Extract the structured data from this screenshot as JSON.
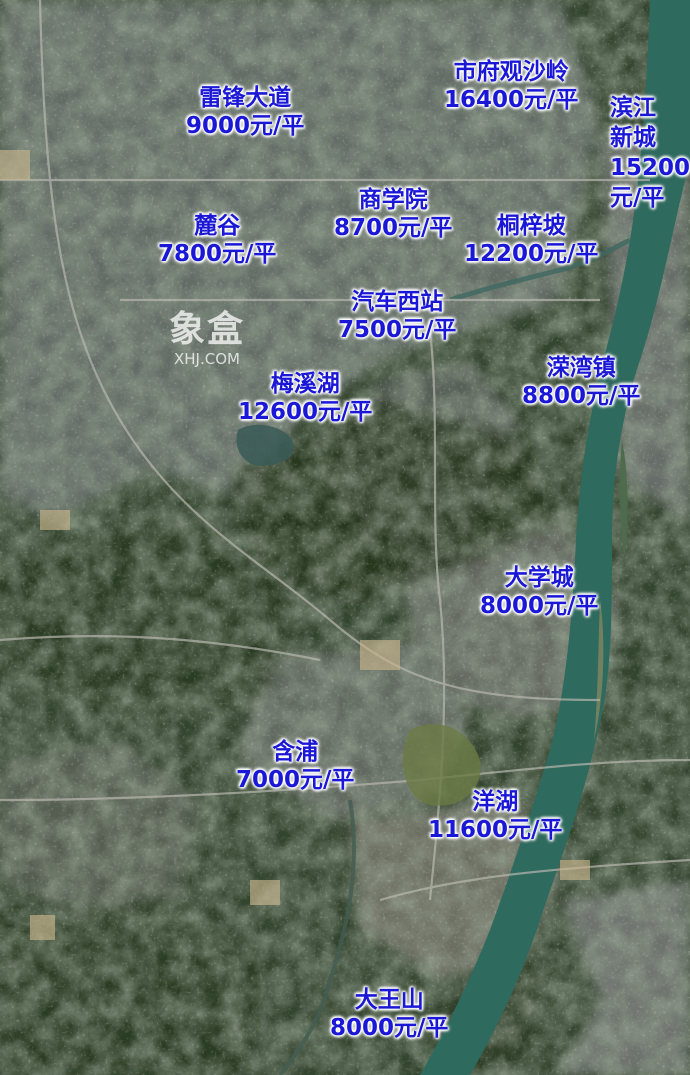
{
  "map": {
    "type": "satellite",
    "label_color": "#1a17d6",
    "river_color": "#2f6a5e",
    "labels": [
      {
        "id": "leifeng",
        "name": "雷锋大道",
        "price": "9000元/平"
      },
      {
        "id": "shifu",
        "name": "市府观沙岭",
        "price": "16400元/平"
      },
      {
        "id": "binjiang",
        "name_lines": [
          "滨江",
          "新城",
          "15200",
          "元/平"
        ]
      },
      {
        "id": "shangxueyuan",
        "name": "商学院",
        "price": "8700元/平"
      },
      {
        "id": "lugu",
        "name": "麓谷",
        "price": "7800元/平"
      },
      {
        "id": "tongzipo",
        "name": "桐梓坡",
        "price": "12200元/平"
      },
      {
        "id": "qichexizhan",
        "name": "汽车西站",
        "price": "7500元/平"
      },
      {
        "id": "meixihu",
        "name": "梅溪湖",
        "price": "12600元/平"
      },
      {
        "id": "lanwanzhen",
        "name": "溁湾镇",
        "price": "8800元/平"
      },
      {
        "id": "daxuecheng",
        "name": "大学城",
        "price": "8000元/平"
      },
      {
        "id": "hanpu",
        "name": "含浦",
        "price": "7000元/平"
      },
      {
        "id": "yanghu",
        "name": "洋湖",
        "price": "11600元/平"
      },
      {
        "id": "dawangshan",
        "name": "大王山",
        "price": "8000元/平"
      }
    ]
  },
  "watermark": {
    "brand_cn": "象盒",
    "brand_en": "XHJ.COM"
  }
}
